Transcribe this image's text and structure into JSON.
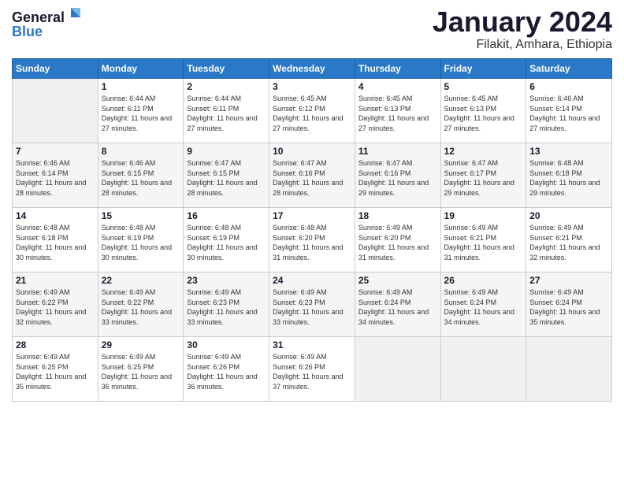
{
  "logo": {
    "text_general": "General",
    "text_blue": "Blue"
  },
  "header": {
    "title": "January 2024",
    "subtitle": "Filakit, Amhara, Ethiopia"
  },
  "weekdays": [
    "Sunday",
    "Monday",
    "Tuesday",
    "Wednesday",
    "Thursday",
    "Friday",
    "Saturday"
  ],
  "weeks": [
    [
      {
        "day": "",
        "sunrise": "",
        "sunset": "",
        "daylight": ""
      },
      {
        "day": "1",
        "sunrise": "Sunrise: 6:44 AM",
        "sunset": "Sunset: 6:11 PM",
        "daylight": "Daylight: 11 hours and 27 minutes."
      },
      {
        "day": "2",
        "sunrise": "Sunrise: 6:44 AM",
        "sunset": "Sunset: 6:11 PM",
        "daylight": "Daylight: 11 hours and 27 minutes."
      },
      {
        "day": "3",
        "sunrise": "Sunrise: 6:45 AM",
        "sunset": "Sunset: 6:12 PM",
        "daylight": "Daylight: 11 hours and 27 minutes."
      },
      {
        "day": "4",
        "sunrise": "Sunrise: 6:45 AM",
        "sunset": "Sunset: 6:13 PM",
        "daylight": "Daylight: 11 hours and 27 minutes."
      },
      {
        "day": "5",
        "sunrise": "Sunrise: 6:45 AM",
        "sunset": "Sunset: 6:13 PM",
        "daylight": "Daylight: 11 hours and 27 minutes."
      },
      {
        "day": "6",
        "sunrise": "Sunrise: 6:46 AM",
        "sunset": "Sunset: 6:14 PM",
        "daylight": "Daylight: 11 hours and 27 minutes."
      }
    ],
    [
      {
        "day": "7",
        "sunrise": "Sunrise: 6:46 AM",
        "sunset": "Sunset: 6:14 PM",
        "daylight": "Daylight: 11 hours and 28 minutes."
      },
      {
        "day": "8",
        "sunrise": "Sunrise: 6:46 AM",
        "sunset": "Sunset: 6:15 PM",
        "daylight": "Daylight: 11 hours and 28 minutes."
      },
      {
        "day": "9",
        "sunrise": "Sunrise: 6:47 AM",
        "sunset": "Sunset: 6:15 PM",
        "daylight": "Daylight: 11 hours and 28 minutes."
      },
      {
        "day": "10",
        "sunrise": "Sunrise: 6:47 AM",
        "sunset": "Sunset: 6:16 PM",
        "daylight": "Daylight: 11 hours and 28 minutes."
      },
      {
        "day": "11",
        "sunrise": "Sunrise: 6:47 AM",
        "sunset": "Sunset: 6:16 PM",
        "daylight": "Daylight: 11 hours and 29 minutes."
      },
      {
        "day": "12",
        "sunrise": "Sunrise: 6:47 AM",
        "sunset": "Sunset: 6:17 PM",
        "daylight": "Daylight: 11 hours and 29 minutes."
      },
      {
        "day": "13",
        "sunrise": "Sunrise: 6:48 AM",
        "sunset": "Sunset: 6:18 PM",
        "daylight": "Daylight: 11 hours and 29 minutes."
      }
    ],
    [
      {
        "day": "14",
        "sunrise": "Sunrise: 6:48 AM",
        "sunset": "Sunset: 6:18 PM",
        "daylight": "Daylight: 11 hours and 30 minutes."
      },
      {
        "day": "15",
        "sunrise": "Sunrise: 6:48 AM",
        "sunset": "Sunset: 6:19 PM",
        "daylight": "Daylight: 11 hours and 30 minutes."
      },
      {
        "day": "16",
        "sunrise": "Sunrise: 6:48 AM",
        "sunset": "Sunset: 6:19 PM",
        "daylight": "Daylight: 11 hours and 30 minutes."
      },
      {
        "day": "17",
        "sunrise": "Sunrise: 6:48 AM",
        "sunset": "Sunset: 6:20 PM",
        "daylight": "Daylight: 11 hours and 31 minutes."
      },
      {
        "day": "18",
        "sunrise": "Sunrise: 6:49 AM",
        "sunset": "Sunset: 6:20 PM",
        "daylight": "Daylight: 11 hours and 31 minutes."
      },
      {
        "day": "19",
        "sunrise": "Sunrise: 6:49 AM",
        "sunset": "Sunset: 6:21 PM",
        "daylight": "Daylight: 11 hours and 31 minutes."
      },
      {
        "day": "20",
        "sunrise": "Sunrise: 6:49 AM",
        "sunset": "Sunset: 6:21 PM",
        "daylight": "Daylight: 11 hours and 32 minutes."
      }
    ],
    [
      {
        "day": "21",
        "sunrise": "Sunrise: 6:49 AM",
        "sunset": "Sunset: 6:22 PM",
        "daylight": "Daylight: 11 hours and 32 minutes."
      },
      {
        "day": "22",
        "sunrise": "Sunrise: 6:49 AM",
        "sunset": "Sunset: 6:22 PM",
        "daylight": "Daylight: 11 hours and 33 minutes."
      },
      {
        "day": "23",
        "sunrise": "Sunrise: 6:49 AM",
        "sunset": "Sunset: 6:23 PM",
        "daylight": "Daylight: 11 hours and 33 minutes."
      },
      {
        "day": "24",
        "sunrise": "Sunrise: 6:49 AM",
        "sunset": "Sunset: 6:23 PM",
        "daylight": "Daylight: 11 hours and 33 minutes."
      },
      {
        "day": "25",
        "sunrise": "Sunrise: 6:49 AM",
        "sunset": "Sunset: 6:24 PM",
        "daylight": "Daylight: 11 hours and 34 minutes."
      },
      {
        "day": "26",
        "sunrise": "Sunrise: 6:49 AM",
        "sunset": "Sunset: 6:24 PM",
        "daylight": "Daylight: 11 hours and 34 minutes."
      },
      {
        "day": "27",
        "sunrise": "Sunrise: 6:49 AM",
        "sunset": "Sunset: 6:24 PM",
        "daylight": "Daylight: 11 hours and 35 minutes."
      }
    ],
    [
      {
        "day": "28",
        "sunrise": "Sunrise: 6:49 AM",
        "sunset": "Sunset: 6:25 PM",
        "daylight": "Daylight: 11 hours and 35 minutes."
      },
      {
        "day": "29",
        "sunrise": "Sunrise: 6:49 AM",
        "sunset": "Sunset: 6:25 PM",
        "daylight": "Daylight: 11 hours and 36 minutes."
      },
      {
        "day": "30",
        "sunrise": "Sunrise: 6:49 AM",
        "sunset": "Sunset: 6:26 PM",
        "daylight": "Daylight: 11 hours and 36 minutes."
      },
      {
        "day": "31",
        "sunrise": "Sunrise: 6:49 AM",
        "sunset": "Sunset: 6:26 PM",
        "daylight": "Daylight: 11 hours and 37 minutes."
      },
      {
        "day": "",
        "sunrise": "",
        "sunset": "",
        "daylight": ""
      },
      {
        "day": "",
        "sunrise": "",
        "sunset": "",
        "daylight": ""
      },
      {
        "day": "",
        "sunrise": "",
        "sunset": "",
        "daylight": ""
      }
    ]
  ]
}
